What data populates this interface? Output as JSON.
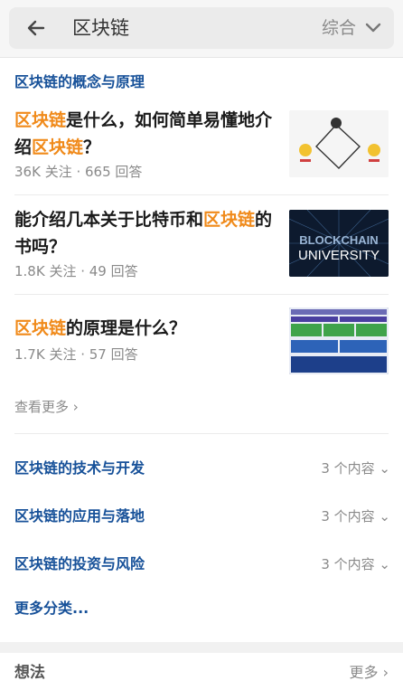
{
  "search": {
    "query": "区块链",
    "sort_label": "综合",
    "back_icon": "arrow-left-icon",
    "sort_icon": "chevron-down-icon"
  },
  "topic": {
    "title": "区块链的概念与原理",
    "questions": [
      {
        "title_parts": [
          {
            "text": "区块链",
            "hl": true
          },
          {
            "text": "是什么，如何简单易懂地介绍",
            "hl": false
          },
          {
            "text": "区块链",
            "hl": true
          },
          {
            "text": "？",
            "hl": false
          }
        ],
        "meta": "36K 关注 · 665 回答",
        "thumb": "diagram"
      },
      {
        "title_parts": [
          {
            "text": "能介绍几本关于比特币和",
            "hl": false
          },
          {
            "text": "区块链",
            "hl": true
          },
          {
            "text": "的书吗？",
            "hl": false
          }
        ],
        "meta": "1.8K 关注 · 49 回答",
        "thumb": "blockchain-university",
        "thumb_text_1": "BLOCKCHAIN",
        "thumb_text_2": "UNIVERSITY"
      },
      {
        "title_parts": [
          {
            "text": "区块链",
            "hl": true
          },
          {
            "text": "的原理是什么？",
            "hl": false
          }
        ],
        "meta": "1.7K 关注 · 57 回答",
        "thumb": "layers"
      }
    ],
    "see_more": "查看更多 ›"
  },
  "categories": [
    {
      "label": "区块链的技术与开发",
      "count": "3 个内容 ⌄"
    },
    {
      "label": "区块链的应用与落地",
      "count": "3 个内容 ⌄"
    },
    {
      "label": "区块链的投资与风险",
      "count": "3 个内容 ⌄"
    }
  ],
  "more_categories": "更多分类...",
  "footer": {
    "title": "想法",
    "more": "更多 ›"
  },
  "colors": {
    "link": "#175199",
    "highlight": "#f08a1a",
    "muted": "#8a8a8a"
  }
}
